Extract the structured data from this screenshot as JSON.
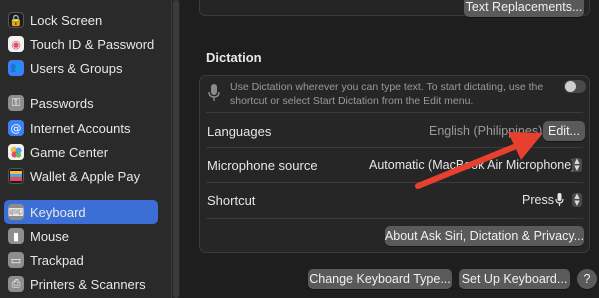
{
  "sidebar": {
    "items": [
      {
        "label": "Lock Screen",
        "icon": "lock-icon",
        "color": "#1c1c1c",
        "glyph": "🔒"
      },
      {
        "label": "Touch ID & Password",
        "icon": "fingerprint-icon",
        "color": "#f2f2f2",
        "glyph": "◉"
      },
      {
        "label": "Users & Groups",
        "icon": "users-icon",
        "color": "#3a80f6",
        "glyph": "👥"
      },
      {
        "label": "Passwords",
        "icon": "key-icon",
        "color": "#8e8e8e",
        "glyph": "⚿"
      },
      {
        "label": "Internet Accounts",
        "icon": "at-icon",
        "color": "#3a80f6",
        "glyph": "@"
      },
      {
        "label": "Game Center",
        "icon": "game-center-icon",
        "color": "#f2f2f2",
        "glyph": "●"
      },
      {
        "label": "Wallet & Apple Pay",
        "icon": "wallet-icon",
        "color": "#1c1c1c",
        "glyph": "▤"
      },
      {
        "label": "Keyboard",
        "icon": "keyboard-icon",
        "color": "#8e8e8e",
        "glyph": "⌨"
      },
      {
        "label": "Mouse",
        "icon": "mouse-icon",
        "color": "#8e8e8e",
        "glyph": "▮"
      },
      {
        "label": "Trackpad",
        "icon": "trackpad-icon",
        "color": "#8e8e8e",
        "glyph": "▭"
      },
      {
        "label": "Printers & Scanners",
        "icon": "printer-icon",
        "color": "#8e8e8e",
        "glyph": "⎙"
      }
    ],
    "selected": "Keyboard"
  },
  "top_button": "Text Replacements...",
  "dictation": {
    "title": "Dictation",
    "info_text": "Use Dictation wherever you can type text. To start dictating, use the shortcut or select Start Dictation from the Edit menu.",
    "toggle_on": false,
    "rows": {
      "languages": {
        "label": "Languages",
        "value": "English (Philippines)",
        "button": "Edit..."
      },
      "microphone": {
        "label": "Microphone source",
        "value": "Automatic (MacBook Air Microphone)"
      },
      "shortcut": {
        "label": "Shortcut",
        "value": "Press"
      }
    },
    "about_button": "About Ask Siri, Dictation & Privacy..."
  },
  "footer": {
    "change_keyboard_type": "Change Keyboard Type...",
    "set_up_keyboard": "Set Up Keyboard...",
    "help": "?"
  },
  "colors": {
    "accent": "#3c6fd6",
    "annotation_arrow": "#e8402f"
  }
}
